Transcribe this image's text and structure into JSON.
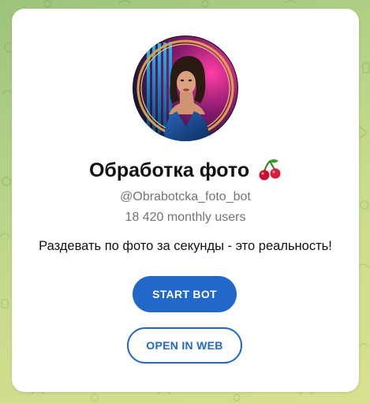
{
  "bot": {
    "name": "Обработка фото",
    "emoji_icon": "cherry-icon",
    "username": "@Obrabotcka_foto_bot",
    "monthly_users": "18 420 monthly users",
    "description": "Раздевать по фото за секунды - это реальность!"
  },
  "actions": {
    "start_label": "START BOT",
    "web_label": "OPEN IN WEB"
  },
  "colors": {
    "accent": "#2168c9",
    "secondary_text": "#707579",
    "background_start": "#9bc47a",
    "background_end": "#d8e08e"
  }
}
